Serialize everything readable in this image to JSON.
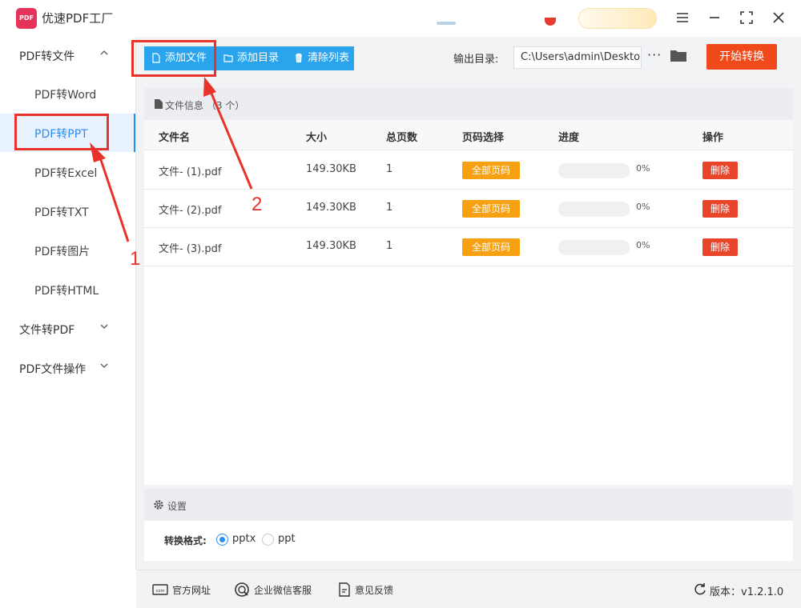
{
  "app": {
    "title": "优速PDF工厂",
    "logo_text": "PDF"
  },
  "sidebar": {
    "groups": [
      {
        "label": "PDF转文件",
        "expanded": true
      },
      {
        "label": "文件转PDF",
        "expanded": false
      },
      {
        "label": "PDF文件操作",
        "expanded": false
      }
    ],
    "items": [
      {
        "label": "PDF转Word"
      },
      {
        "label": "PDF转PPT",
        "active": true
      },
      {
        "label": "PDF转Excel"
      },
      {
        "label": "PDF转TXT"
      },
      {
        "label": "PDF转图片"
      },
      {
        "label": "PDF转HTML"
      }
    ]
  },
  "toolbar": {
    "add_file": "添加文件",
    "add_dir": "添加目录",
    "clear_list": "清除列表",
    "output_label": "输出目录:",
    "output_path": "C:\\Users\\admin\\Deskto",
    "more": "···",
    "start": "开始转换"
  },
  "file_panel": {
    "header": "文件信息 （3 个）",
    "columns": [
      "文件名",
      "大小",
      "总页数",
      "页码选择",
      "进度",
      "操作"
    ],
    "rows": [
      {
        "name": "文件- (1).pdf",
        "size": "149.30KB",
        "pages": "1",
        "page_select": "全部页码",
        "progress": 0,
        "progress_text": "0%",
        "action": "删除"
      },
      {
        "name": "文件- (2).pdf",
        "size": "149.30KB",
        "pages": "1",
        "page_select": "全部页码",
        "progress": 0,
        "progress_text": "0%",
        "action": "删除"
      },
      {
        "name": "文件- (3).pdf",
        "size": "149.30KB",
        "pages": "1",
        "page_select": "全部页码",
        "progress": 0,
        "progress_text": "0%",
        "action": "删除"
      }
    ]
  },
  "settings": {
    "header": "设置",
    "format_label": "转换格式:",
    "options": [
      {
        "label": "pptx",
        "selected": true
      },
      {
        "label": "ppt",
        "selected": false
      }
    ]
  },
  "footer": {
    "website": "官方网址",
    "wechat": "企业微信客服",
    "feedback": "意见反馈",
    "version": "版本：v1.2.1.0"
  },
  "annotations": {
    "marker_1": "1",
    "marker_2": "2"
  },
  "colors": {
    "accent_blue": "#2ba4ee",
    "start_button": "#f04a1a",
    "page_select": "#f7a011",
    "delete": "#e8452a",
    "annotation": "#e8332a"
  }
}
